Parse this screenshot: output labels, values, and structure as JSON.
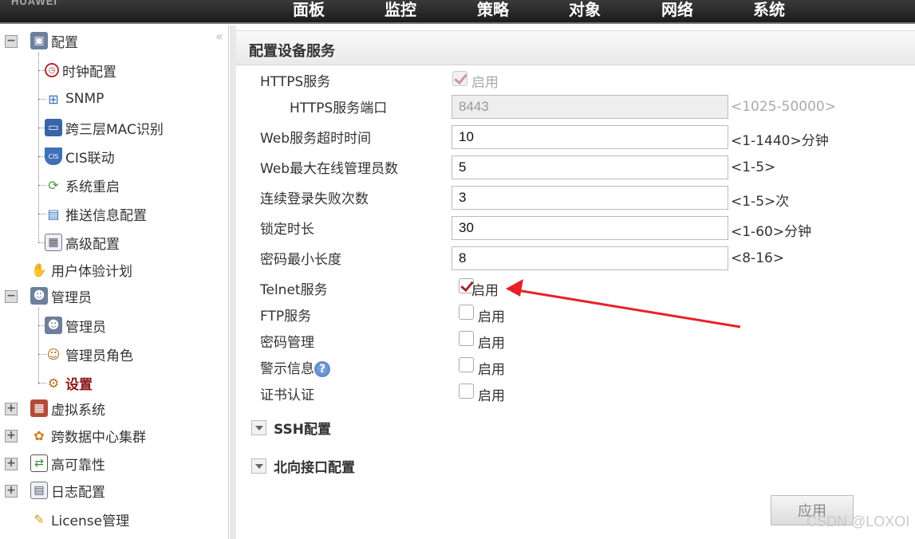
{
  "header": {
    "logo": "HUAWEI",
    "nav": [
      "面板",
      "监控",
      "策略",
      "对象",
      "网络",
      "系统"
    ]
  },
  "sidebar": {
    "collapse_glyph": "«",
    "tree": [
      {
        "label": "配置",
        "level": 0,
        "toggle": "−",
        "icon": "config-icon"
      },
      {
        "label": "时钟配置",
        "level": 1,
        "icon": "clock-icon"
      },
      {
        "label": "SNMP",
        "level": 1,
        "icon": "snmp-icon"
      },
      {
        "label": "跨三层MAC识别",
        "level": 1,
        "icon": "monitor-icon"
      },
      {
        "label": "CIS联动",
        "level": 1,
        "icon": "cis-shield-icon"
      },
      {
        "label": "系统重启",
        "level": 1,
        "icon": "restart-icon"
      },
      {
        "label": "推送信息配置",
        "level": 1,
        "icon": "push-message-icon"
      },
      {
        "label": "高级配置",
        "level": 1,
        "icon": "advanced-config-icon"
      },
      {
        "label": "用户体验计划",
        "level": 0,
        "icon": "user-experience-icon"
      },
      {
        "label": "管理员",
        "level": 0,
        "toggle": "−",
        "icon": "admin-icon"
      },
      {
        "label": "管理员",
        "level": 1,
        "icon": "admin-icon"
      },
      {
        "label": "管理员角色",
        "level": 1,
        "icon": "admin-role-icon"
      },
      {
        "label": "设置",
        "level": 1,
        "icon": "settings-icon",
        "active": true
      },
      {
        "label": "虚拟系统",
        "level": 0,
        "toggle": "+",
        "icon": "virtual-system-icon"
      },
      {
        "label": "跨数据中心集群",
        "level": 0,
        "toggle": "+",
        "icon": "cluster-icon"
      },
      {
        "label": "高可靠性",
        "level": 0,
        "toggle": "+",
        "icon": "high-availability-icon"
      },
      {
        "label": "日志配置",
        "level": 0,
        "toggle": "+",
        "icon": "log-config-icon"
      },
      {
        "label": "License管理",
        "level": 0,
        "icon": "license-icon"
      }
    ]
  },
  "main": {
    "title": "配置设备服务",
    "https": {
      "label": "HTTPS服务",
      "checkbox_label": "启用",
      "checked": true,
      "disabled": true
    },
    "https_port": {
      "label": "HTTPS服务端口",
      "value": "8443",
      "hint": "<1025-50000>",
      "disabled": true
    },
    "fields": [
      {
        "label": "Web服务超时时间",
        "value": "10",
        "hint": "<1-1440>分钟"
      },
      {
        "label": "Web最大在线管理员数",
        "value": "5",
        "hint": "<1-5>"
      },
      {
        "label": "连续登录失败次数",
        "value": "3",
        "hint": "<1-5>次"
      },
      {
        "label": "锁定时长",
        "value": "30",
        "hint": "<1-60>分钟"
      },
      {
        "label": "密码最小长度",
        "value": "8",
        "hint": "<8-16>"
      }
    ],
    "toggles": [
      {
        "label": "Telnet服务",
        "checkbox_label": "启用",
        "checked": true
      },
      {
        "label": "FTP服务",
        "checkbox_label": "启用",
        "checked": false
      },
      {
        "label": "密码管理",
        "checkbox_label": "启用",
        "checked": false
      },
      {
        "label": "警示信息",
        "checkbox_label": "启用",
        "checked": false,
        "help": "?"
      },
      {
        "label": "证书认证",
        "checkbox_label": "启用",
        "checked": false
      }
    ],
    "sections": [
      "SSH配置",
      "北向接口配置"
    ],
    "apply_label": "应用",
    "annotation_arrow_color": "#e8202a"
  },
  "watermark": "CSDN @LOXOI"
}
